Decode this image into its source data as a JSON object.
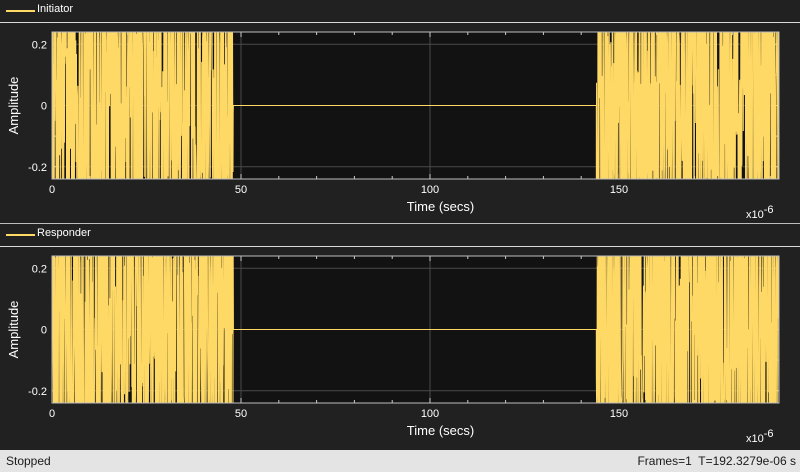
{
  "colors": {
    "background": "#212121",
    "axes_background": "#121212",
    "trace": "#ffd966",
    "grid": "#4a4a4a",
    "status_bar": "#e4e4e4"
  },
  "status": {
    "state": "Stopped",
    "frames": "Frames=1",
    "time": "T=192.3279e-06 s"
  },
  "chart_data": [
    {
      "type": "line",
      "series": [
        {
          "name": "Initiator",
          "color": "#ffd966"
        }
      ],
      "segments": [
        {
          "x_start": 0,
          "x_end": 48,
          "behavior": "dense random noise",
          "amplitude_range": [
            -0.24,
            0.24
          ]
        },
        {
          "x_start": 48,
          "x_end": 144,
          "behavior": "flat",
          "value": 0
        },
        {
          "x_start": 144,
          "x_end": 192.33,
          "behavior": "dense random noise",
          "amplitude_range": [
            -0.24,
            0.24
          ]
        }
      ],
      "xlabel": "Time (secs)",
      "x_exponent_base": "x10",
      "x_exponent": "-6",
      "ylabel": "Amplitude",
      "xlim": [
        0,
        192.3279
      ],
      "ylim": [
        -0.24,
        0.24
      ],
      "xticks": [
        "0",
        "50",
        "100",
        "150"
      ],
      "xtick_values": [
        0,
        50,
        100,
        150
      ],
      "yticks": [
        "0.2",
        "0",
        "-0.2"
      ],
      "ytick_values": [
        0.2,
        0,
        -0.2
      ],
      "grid": true,
      "legend": "top-left"
    },
    {
      "type": "line",
      "series": [
        {
          "name": "Responder",
          "color": "#ffd966"
        }
      ],
      "segments": [
        {
          "x_start": 0,
          "x_end": 48,
          "behavior": "dense random noise",
          "amplitude_range": [
            -0.24,
            0.24
          ]
        },
        {
          "x_start": 48,
          "x_end": 144,
          "behavior": "flat",
          "value": 0
        },
        {
          "x_start": 144,
          "x_end": 192.33,
          "behavior": "dense random noise",
          "amplitude_range": [
            -0.24,
            0.24
          ]
        }
      ],
      "xlabel": "Time (secs)",
      "x_exponent_base": "x10",
      "x_exponent": "-6",
      "ylabel": "Amplitude",
      "xlim": [
        0,
        192.3279
      ],
      "ylim": [
        -0.24,
        0.24
      ],
      "xticks": [
        "0",
        "50",
        "100",
        "150"
      ],
      "xtick_values": [
        0,
        50,
        100,
        150
      ],
      "yticks": [
        "0.2",
        "0",
        "-0.2"
      ],
      "ytick_values": [
        0.2,
        0,
        -0.2
      ],
      "grid": true,
      "legend": "top-left"
    }
  ]
}
